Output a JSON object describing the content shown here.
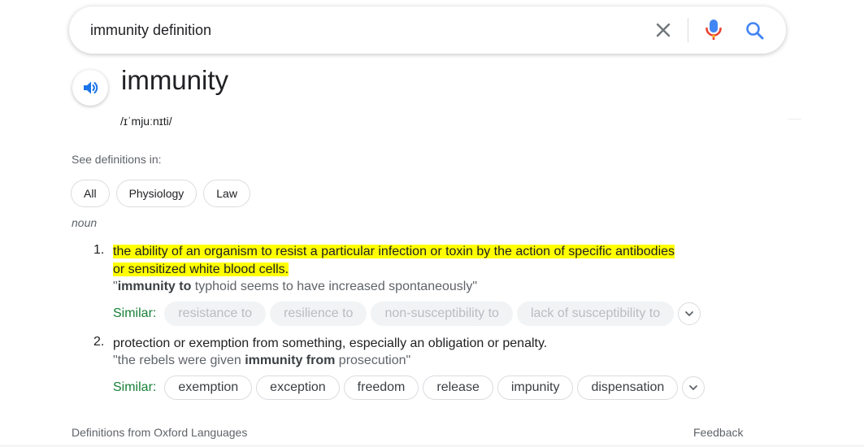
{
  "search": {
    "query": "immunity definition",
    "icons": {
      "clear": "close-icon",
      "voice": "mic-icon",
      "submit": "search-icon"
    }
  },
  "entry": {
    "word": "immunity",
    "phonetic": "/ɪˈmjuːnɪti/",
    "speaker_icon": "speaker-icon",
    "see_definitions_label": "See definitions in:",
    "filters": [
      "All",
      "Physiology",
      "Law"
    ],
    "part_of_speech": "noun"
  },
  "senses": [
    {
      "number": "1.",
      "definition_line1": "the ability of an organism to resist a particular infection or toxin by the action of specific antibodies",
      "definition_line2": "or sensitized white blood cells.",
      "example_open": "\"",
      "example_bold": "immunity to",
      "example_rest": " typhoid seems to have increased spontaneously\"",
      "similar_label": "Similar:",
      "similar": [
        "resistance to",
        "resilience to",
        "non-susceptibility to",
        "lack of susceptibility to"
      ]
    },
    {
      "number": "2.",
      "definition_line1": "protection or exemption from something, especially an obligation or penalty.",
      "example_open": "\"the rebels were given ",
      "example_bold": "immunity from",
      "example_rest": " prosecution\"",
      "similar_label": "Similar:",
      "similar": [
        "exemption",
        "exception",
        "freedom",
        "release",
        "impunity",
        "dispensation"
      ]
    }
  ],
  "footer": {
    "source": "Definitions from Oxford Languages",
    "feedback": "Feedback"
  },
  "colors": {
    "highlight": "#ffff00",
    "similar_label": "#188038",
    "mic_blue": "#4285f4",
    "mic_red": "#ea4335",
    "speaker_blue": "#1a73e8"
  }
}
